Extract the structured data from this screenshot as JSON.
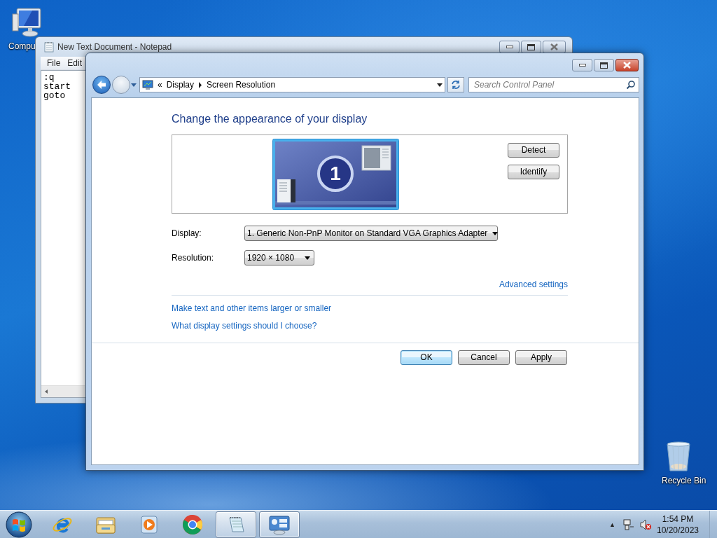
{
  "desktop_icons": [
    {
      "kind": "computer",
      "label": "Compu"
    },
    {
      "kind": "recycle_bin",
      "label": "Recycle Bin"
    }
  ],
  "notepad": {
    "title": "New Text Document - Notepad",
    "menu": [
      "File",
      "Edit"
    ],
    "lines": [
      ":q",
      "start",
      "goto"
    ]
  },
  "control_panel": {
    "address": {
      "overflow": "«",
      "path": [
        "Display",
        "Screen Resolution"
      ]
    },
    "search": {
      "placeholder": "Search Control Panel"
    },
    "heading": "Change the appearance of your display",
    "monitor_label": "1",
    "monitor_buttons": [
      "Detect",
      "Identify"
    ],
    "fields": [
      {
        "label": "Display:",
        "value": "1. Generic Non-PnP Monitor on Standard VGA Graphics Adapter"
      },
      {
        "label": "Resolution:",
        "value": "1920 × 1080"
      }
    ],
    "advanced_link": "Advanced settings",
    "links": [
      "Make text and other items larger or smaller",
      "What display settings should I choose?"
    ],
    "buttons": [
      {
        "label": "OK",
        "default": true
      },
      {
        "label": "Cancel",
        "default": false
      },
      {
        "label": "Apply",
        "default": false
      }
    ]
  },
  "taskbar": {
    "items": [
      {
        "kind": "start",
        "open": false
      },
      {
        "kind": "ie",
        "open": false
      },
      {
        "kind": "explorer",
        "open": false
      },
      {
        "kind": "media",
        "open": false
      },
      {
        "kind": "chrome",
        "open": false
      },
      {
        "kind": "notepad",
        "open": true
      },
      {
        "kind": "control_panel",
        "open": true
      }
    ],
    "tray_arrow": "▲",
    "time": "1:54 PM",
    "date": "10/20/2023"
  }
}
